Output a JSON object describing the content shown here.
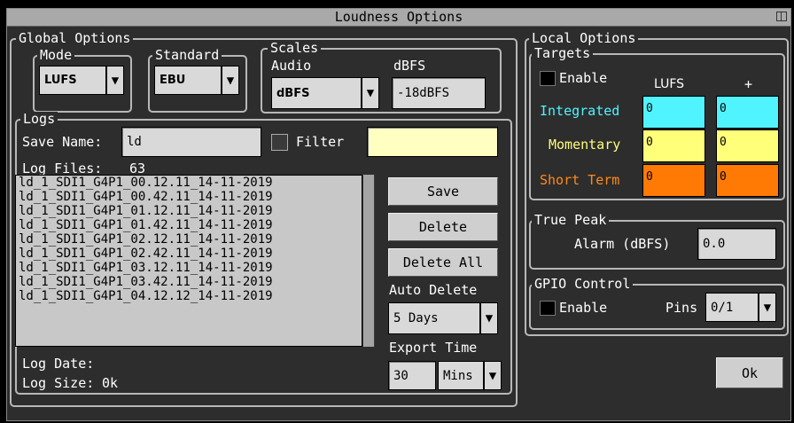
{
  "window": {
    "title": "Loudness Options",
    "icon": "restore-icon"
  },
  "global": {
    "legend": "Global Options",
    "mode": {
      "legend": "Mode",
      "value": "LUFS"
    },
    "standard": {
      "legend": "Standard",
      "value": "EBU"
    },
    "scales": {
      "legend": "Scales",
      "audio_label": "Audio",
      "audio_value": "dBFS",
      "dbfs_label": "dBFS",
      "dbfs_value": "-18dBFS"
    }
  },
  "logs": {
    "legend": "Logs",
    "save_name_label": "Save Name:",
    "save_name_value": "ld",
    "filter_label": "Filter",
    "filter_value": "",
    "log_files_label": "Log Files:",
    "log_files_count": "63",
    "files": [
      "ld_1_SDI1_G4P1_00.12.11_14-11-2019",
      "ld_1_SDI1_G4P1_00.42.11_14-11-2019",
      "ld_1_SDI1_G4P1_01.12.11_14-11-2019",
      "ld_1_SDI1_G4P1_01.42.11_14-11-2019",
      "ld_1_SDI1_G4P1_02.12.11_14-11-2019",
      "ld_1_SDI1_G4P1_02.42.11_14-11-2019",
      "ld_1_SDI1_G4P1_03.12.11_14-11-2019",
      "ld_1_SDI1_G4P1_03.42.11_14-11-2019",
      "ld_1_SDI1_G4P1_04.12.12_14-11-2019"
    ],
    "save_button": "Save",
    "delete_button": "Delete",
    "delete_all_button": "Delete All",
    "auto_delete_label": "Auto Delete",
    "auto_delete_value": "5 Days",
    "export_time_label": "Export Time",
    "export_time_value": "30",
    "export_time_unit": "Mins",
    "log_date_label": "Log Date:",
    "log_date_value": "",
    "log_size_label": "Log Size:",
    "log_size_value": "0k"
  },
  "local": {
    "legend": "Local Options",
    "targets": {
      "legend": "Targets",
      "enable_label": "Enable",
      "col_lufs": "LUFS",
      "col_plus": "+",
      "rows": [
        {
          "label": "Integrated",
          "lufs": "0",
          "plus": "0",
          "color": "#4ff4ff",
          "label_color": "#4ff4ff"
        },
        {
          "label": "Momentary",
          "lufs": "0",
          "plus": "0",
          "color": "#ffff7a",
          "label_color": "#ffff7a"
        },
        {
          "label": "Short Term",
          "lufs": "0",
          "plus": "0",
          "color": "#ff7a05",
          "label_color": "#ff8a1a"
        }
      ]
    },
    "true_peak": {
      "legend": "True Peak",
      "alarm_label": "Alarm (dBFS)",
      "alarm_value": "0.0"
    },
    "gpio": {
      "legend": "GPIO Control",
      "enable_label": "Enable",
      "pins_label": "Pins",
      "pins_value": "0/1"
    }
  },
  "ok_button": "Ok"
}
